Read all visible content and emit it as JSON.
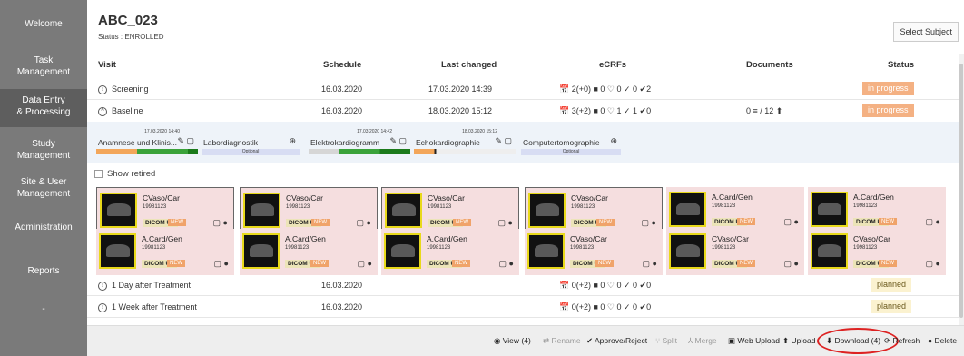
{
  "sidebar": {
    "items": [
      {
        "label": "Welcome"
      },
      {
        "label": "Task\nManagement"
      },
      {
        "label": "Data Entry\n& Processing"
      },
      {
        "label": "Study\nManagement"
      },
      {
        "label": "Site & User\nManagement"
      },
      {
        "label": "Administration"
      },
      {
        "label": "Reports"
      },
      {
        "label": "-"
      }
    ]
  },
  "subject": {
    "title": "ABC_023",
    "status": "Status : ENROLLED",
    "select_label": "Select Subject"
  },
  "columns": {
    "visit": "Visit",
    "schedule": "Schedule",
    "last_changed": "Last changed",
    "ecrfs": "eCRFs",
    "documents": "Documents",
    "status": "Status"
  },
  "visits": [
    {
      "toggle": "›",
      "name": "Screening",
      "schedule": "16.03.2020",
      "last_changed": "17.03.2020 14:39",
      "ecrfs": "📅 2(+0) ■ 0 ♡ 0 ✓ 0 ✔2",
      "documents": "",
      "status": "in progress"
    },
    {
      "toggle": "^",
      "name": "Baseline",
      "schedule": "16.03.2020",
      "last_changed": "18.03.2020 15:12",
      "ecrfs": "📅 3(+2) ■ 0 ♡ 1 ✓ 1 ✔0",
      "documents": "0 ≡ / 12 ⬆",
      "status": "in progress"
    },
    {
      "toggle": "›",
      "name": "1 Day after Treatment",
      "schedule": "16.03.2020",
      "last_changed": "",
      "ecrfs": "📅 0(+2) ■ 0 ♡ 0 ✓ 0 ✔0",
      "documents": "",
      "status": "planned"
    },
    {
      "toggle": "›",
      "name": "1 Week after Treatment",
      "schedule": "16.03.2020",
      "last_changed": "",
      "ecrfs": "📅 0(+2) ■ 0 ♡ 0 ✓ 0 ✔0",
      "documents": "",
      "status": "planned"
    }
  ],
  "crfs": [
    {
      "ts": "17.03.2020 14:40",
      "name": "Anamnese und Klinis...",
      "icons": "✎ ▢",
      "optional": ""
    },
    {
      "ts": "",
      "name": "Labordiagnostik",
      "icons": "⊕",
      "optional": "Optional"
    },
    {
      "ts": "17.03.2020 14:42",
      "name": "Elektrokardiogramm",
      "icons": "✎ ▢",
      "optional": ""
    },
    {
      "ts": "18.03.2020 15:12",
      "name": "Echokardiographie",
      "icons": "✎ ▢",
      "optional": ""
    },
    {
      "ts": "",
      "name": "Computertomographie",
      "icons": "⊕",
      "optional": "Optional"
    }
  ],
  "show_retired": "Show retired",
  "documents": [
    {
      "title": "CVaso/Car",
      "id": "19981123",
      "dicom": "DICOM US",
      "new": "NEW",
      "icons": "▢ ●"
    },
    {
      "title": "CVaso/Car",
      "id": "19981123",
      "dicom": "DICOM US",
      "new": "NEW",
      "icons": "▢ ●"
    },
    {
      "title": "CVaso/Car",
      "id": "19981123",
      "dicom": "DICOM US",
      "new": "NEW",
      "icons": "▢ ●"
    },
    {
      "title": "CVaso/Car",
      "id": "19981123",
      "dicom": "DICOM US",
      "new": "NEW",
      "icons": "▢ ●"
    },
    {
      "title": "A.Card/Gen",
      "id": "19981123",
      "dicom": "DICOM US",
      "new": "NEW",
      "icons": "▢ ●"
    },
    {
      "title": "A.Card/Gen",
      "id": "19981123",
      "dicom": "DICOM US",
      "new": "NEW",
      "icons": "▢ ●"
    },
    {
      "title": "A.Card/Gen",
      "id": "19981123",
      "dicom": "DICOM US",
      "new": "NEW",
      "icons": "▢ ●"
    },
    {
      "title": "A.Card/Gen",
      "id": "19981123",
      "dicom": "DICOM US",
      "new": "NEW",
      "icons": "▢ ●"
    },
    {
      "title": "A.Card/Gen",
      "id": "19981123",
      "dicom": "DICOM US",
      "new": "NEW",
      "icons": "▢ ●"
    },
    {
      "title": "CVaso/Car",
      "id": "19981123",
      "dicom": "DICOM US",
      "new": "NEW",
      "icons": "▢ ●"
    },
    {
      "title": "CVaso/Car",
      "id": "19981123",
      "dicom": "DICOM US",
      "new": "NEW",
      "icons": "▢ ●"
    },
    {
      "title": "CVaso/Car",
      "id": "19981123",
      "dicom": "DICOM US",
      "new": "NEW",
      "icons": "▢ ●"
    }
  ],
  "toolbar": {
    "view": "◉ View (4)",
    "rename": "⇄ Rename",
    "approve": "✔ Approve/Reject",
    "split": "⑂ Split",
    "merge": "⅄ Merge",
    "web_upload": "▣ Web Upload",
    "upload": "⬆ Upload",
    "download": "⬇ Download (4)",
    "refresh": "⟳ Refresh",
    "delete": "● Delete"
  },
  "colors": {
    "sidebar": "#7a7a7a",
    "in_progress": "#f4b183",
    "planned": "#fbf2d0",
    "doc_bg": "#f5dedf",
    "highlight_oval": "#dd2222"
  }
}
